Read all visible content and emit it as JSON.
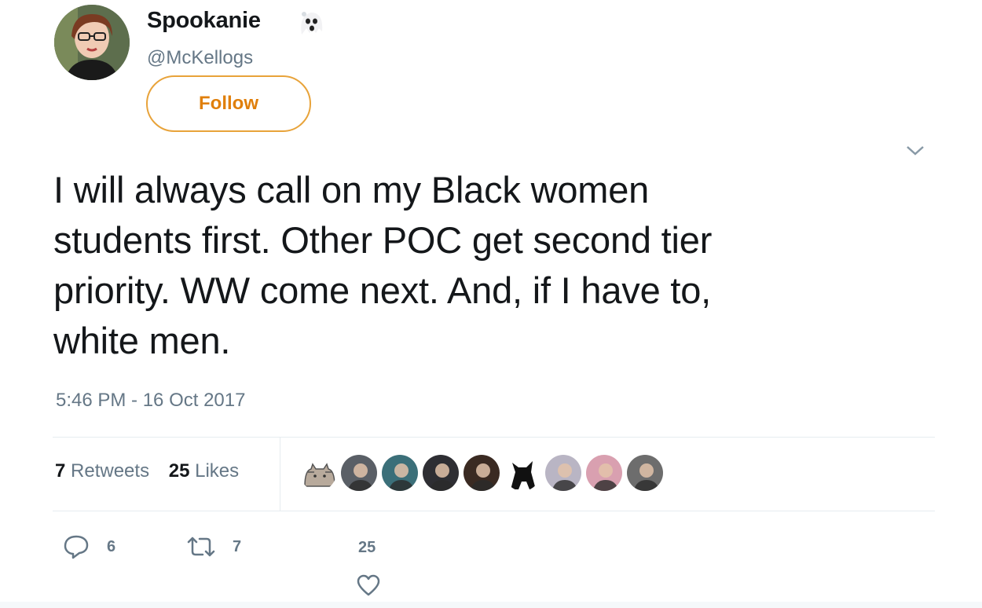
{
  "author": {
    "display_name": "Spookanie",
    "handle": "@McKellogs",
    "name_emoji_icon": "ghost-icon"
  },
  "follow_button": {
    "label": "Follow"
  },
  "tweet": {
    "text_lines": [
      "I will always call on my Black women",
      "students first. Other POC get second tier",
      "priority. WW come next. And, if I have to,",
      "white men."
    ],
    "timestamp": "5:46 PM - 16 Oct 2017"
  },
  "stats": {
    "retweets_count": "7",
    "retweets_label": "Retweets",
    "likes_count": "25",
    "likes_label": "Likes"
  },
  "likers": [
    {
      "kind": "pusheen-cat"
    },
    {
      "kind": "photo",
      "color": "#5a5f66"
    },
    {
      "kind": "photo",
      "color": "#3b6f79"
    },
    {
      "kind": "photo",
      "color": "#2e2e33"
    },
    {
      "kind": "photo",
      "color": "#3a2a22"
    },
    {
      "kind": "black-cat"
    },
    {
      "kind": "photo",
      "color": "#b9b5c4"
    },
    {
      "kind": "photo",
      "color": "#d9a0b0"
    },
    {
      "kind": "photo",
      "color": "#6d6d6d"
    }
  ],
  "actions": {
    "reply_count": "6",
    "retweet_count": "7",
    "like_count": "25"
  },
  "colors": {
    "follow_accent": "#e8a33a",
    "muted_text": "#657786"
  }
}
